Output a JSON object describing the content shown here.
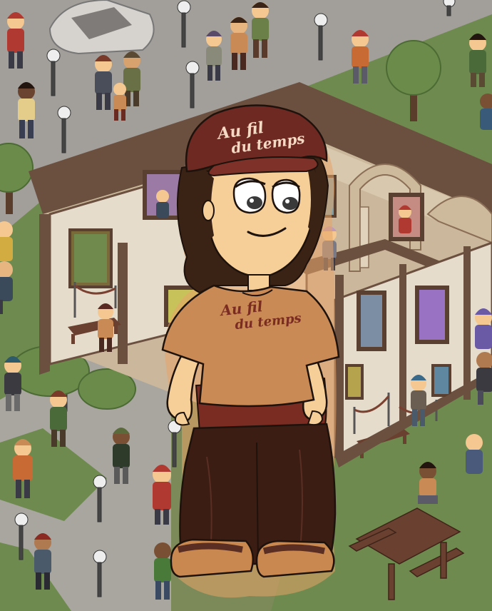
{
  "illustration": {
    "cap_brand_line1": "Au fil",
    "cap_brand_line2": "du temps",
    "shirt_brand_line1": "Au fil",
    "shirt_brand_line2": "du temps",
    "colors": {
      "grass": "#6e8a4e",
      "grass_dark": "#5c7740",
      "path": "#a9a6a0",
      "path_edge": "#85817c",
      "building_wall": "#e6dccb",
      "building_frame": "#6b5040",
      "building_floor": "#cbb79b",
      "cap": "#6e2a22",
      "skin": "#f6cf98",
      "hair": "#3a2215",
      "shirt": "#c98a55",
      "undershirt": "#7a2c22",
      "pants": "#3b1d14",
      "shoes": "#c98850",
      "table": "#6a4030"
    }
  }
}
